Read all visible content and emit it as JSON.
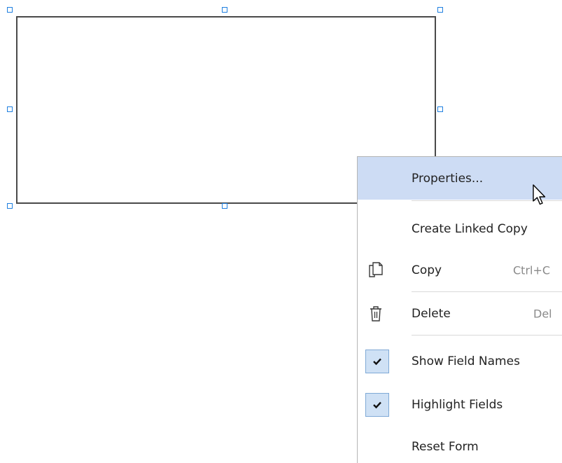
{
  "colors": {
    "handle_border": "#1e7fe0",
    "field_border": "#4a4a4a",
    "menu_highlight": "#cddcf4",
    "check_bg": "#cfe1f5"
  },
  "context_menu": {
    "items": [
      {
        "label": "Properties...",
        "shortcut": "",
        "icon": "",
        "highlighted": true
      },
      {
        "label": "Create Linked Copy",
        "shortcut": "",
        "icon": ""
      },
      {
        "label": "Copy",
        "shortcut": "Ctrl+C",
        "icon": "copy-icon"
      },
      {
        "label": "Delete",
        "shortcut": "Del",
        "icon": "trash-icon"
      },
      {
        "label": "Show Field Names",
        "shortcut": "",
        "icon": "checkmark-icon",
        "checked": true
      },
      {
        "label": "Highlight Fields",
        "shortcut": "",
        "icon": "checkmark-icon",
        "checked": true
      },
      {
        "label": "Reset Form",
        "shortcut": "",
        "icon": ""
      }
    ]
  }
}
